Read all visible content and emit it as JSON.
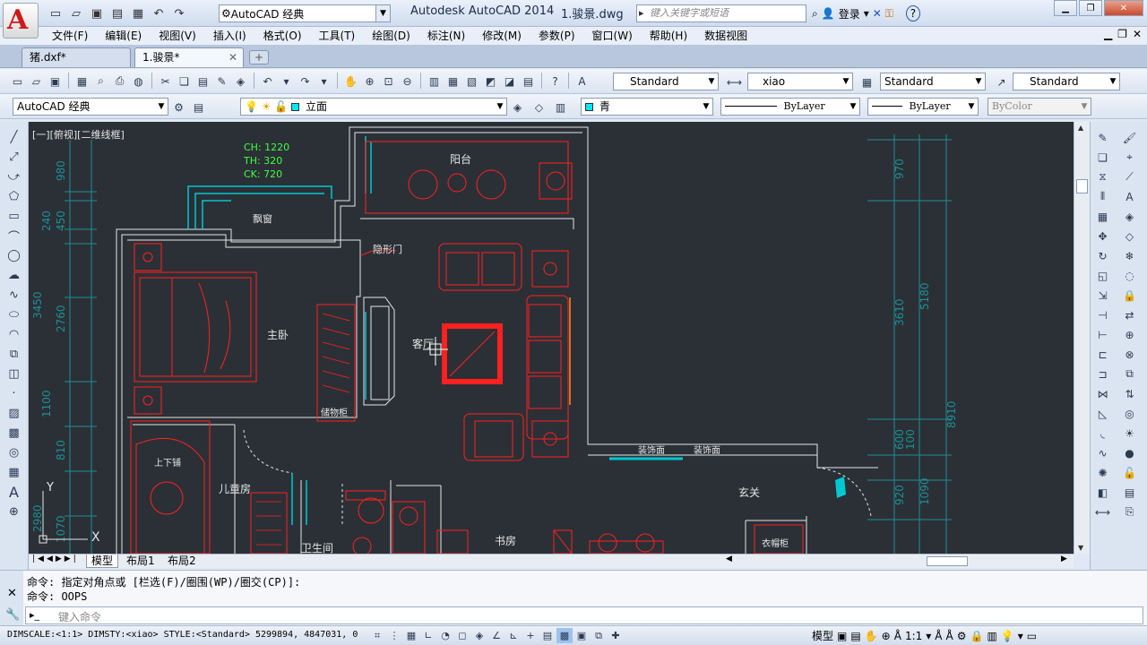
{
  "titlebar": {
    "app_letter": "A",
    "workspace": "AutoCAD 经典",
    "app_name": "Autodesk AutoCAD 2014",
    "file_name": "1.骏景.dwg",
    "search_placeholder": "键入关键字或短语",
    "user_label": "登录",
    "help_label": "?"
  },
  "menu": [
    "文件(F)",
    "编辑(E)",
    "视图(V)",
    "插入(I)",
    "格式(O)",
    "工具(T)",
    "绘图(D)",
    "标注(N)",
    "修改(M)",
    "参数(P)",
    "窗口(W)",
    "帮助(H)",
    "数据视图"
  ],
  "file_tabs": [
    "猪.dxf*",
    "1.骏景*"
  ],
  "styles_toolbar": {
    "text_style": "Standard",
    "dim_style": "xiao",
    "table_style": "Standard",
    "multileader_style": "Standard"
  },
  "layers_toolbar": {
    "workspace": "AutoCAD 经典",
    "layer": "立面",
    "color": "青",
    "linetype": "ByLayer",
    "lineweight": "ByLayer",
    "plotstyle": "ByColor"
  },
  "viewport_label": "[一][俯视][二维线框]",
  "annotations": {
    "ch": "CH: 1220",
    "th": "TH: 320",
    "ck": "CK: 720"
  },
  "rooms": {
    "balcony": "阳台",
    "bay_window": "飘窗",
    "hidden_door": "隐形门",
    "master_bedroom": "主卧",
    "living_room": "客厅",
    "wardrobe": "储物柜",
    "deco_wall_1": "装饰面",
    "deco_wall_2": "装饰面",
    "bunk_bed": "上下铺",
    "kids_room": "儿童房",
    "bathroom": "卫生间",
    "study": "书房",
    "entrance": "玄关",
    "shoe_cabinet": "衣帽柜"
  },
  "dimensions_left": [
    "980",
    "240",
    "450",
    "3450",
    "2760",
    "1100",
    "810",
    "2980",
    "1070"
  ],
  "dimensions_right": [
    "970",
    "3610",
    "5180",
    "8910",
    "600",
    "100",
    "920",
    "1090"
  ],
  "ucs": {
    "x": "X",
    "y": "Y"
  },
  "layout_tabs": [
    "模型",
    "布局1",
    "布局2"
  ],
  "command": {
    "line1": "命令: 指定对角点或 [栏选(F)/圈围(WP)/圈交(CP)]:",
    "line2": "命令: OOPS",
    "placeholder": "键入命令"
  },
  "status": {
    "info": "DIMSCALE:<1:1> DIMSTY:<xiao> STYLE:<Standard>   5299894, 4847031, 0",
    "model": "模型",
    "scale": "1:1"
  },
  "colors": {
    "canvas": "#2b3036",
    "cad_red": "#ff2020",
    "cad_white": "#e6e6e6",
    "cad_cyan": "#00c8d2",
    "cad_teal": "#1d8f96",
    "cad_green": "#40ff40"
  }
}
